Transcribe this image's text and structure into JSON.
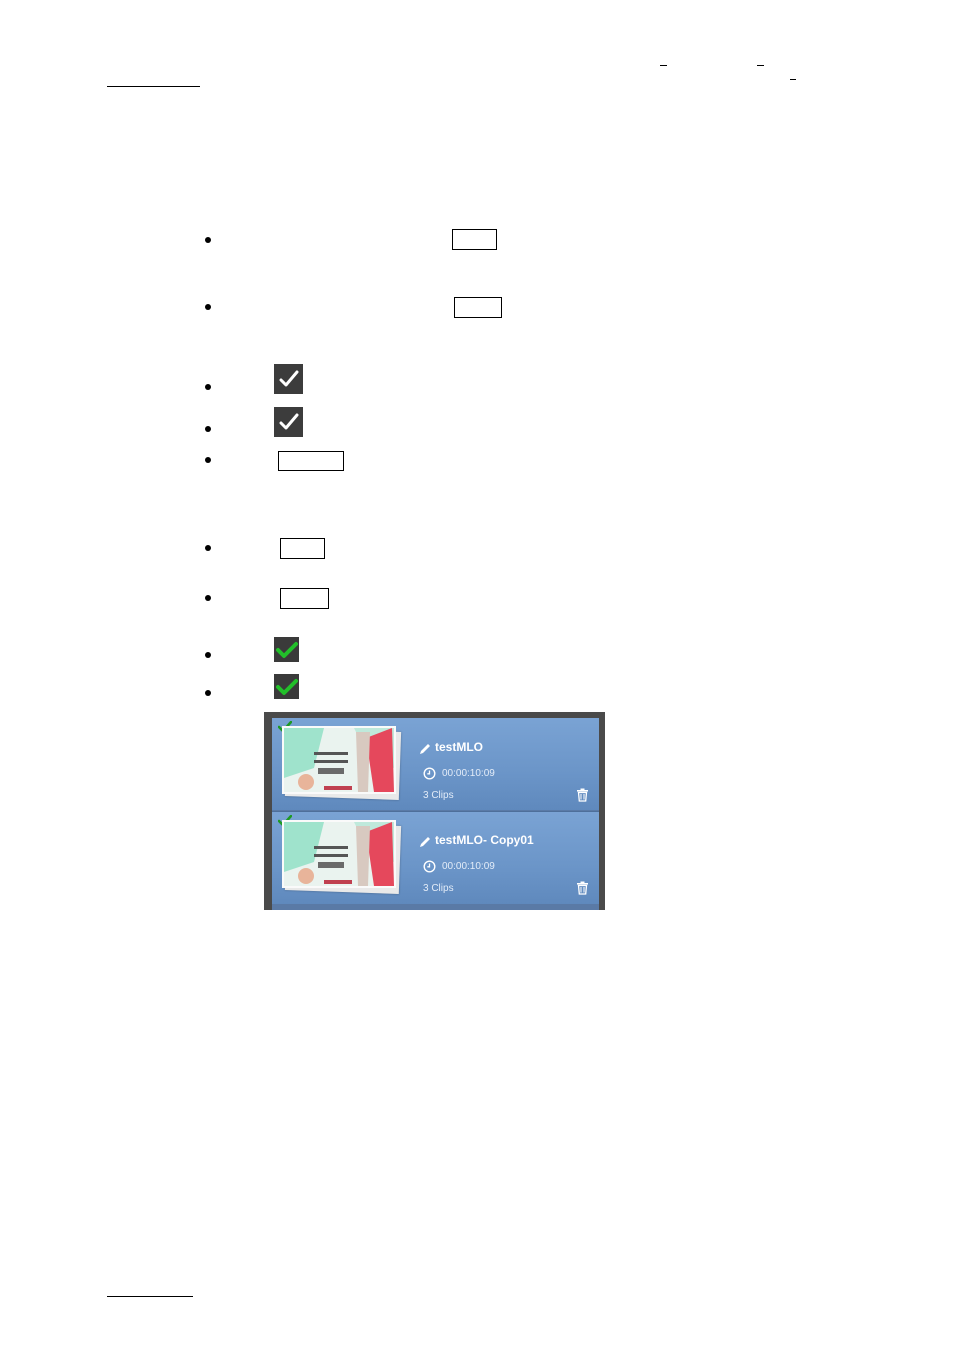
{
  "list": {
    "items": [
      {
        "title": "testMLO",
        "duration": "00:00:10:09",
        "clips": "3 Clips"
      },
      {
        "title": "testMLO- Copy01",
        "duration": "00:00:10:09",
        "clips": "3 Clips"
      }
    ]
  },
  "colors": {
    "panel_bg": "#4a4a4a",
    "item_blue": "#7aa3d4",
    "check_green": "#22c02a",
    "check_dark_bg": "#3c3c3c"
  },
  "icons": [
    "check-icon",
    "green-check-icon",
    "pencil-icon",
    "clock-icon",
    "trash-icon"
  ]
}
